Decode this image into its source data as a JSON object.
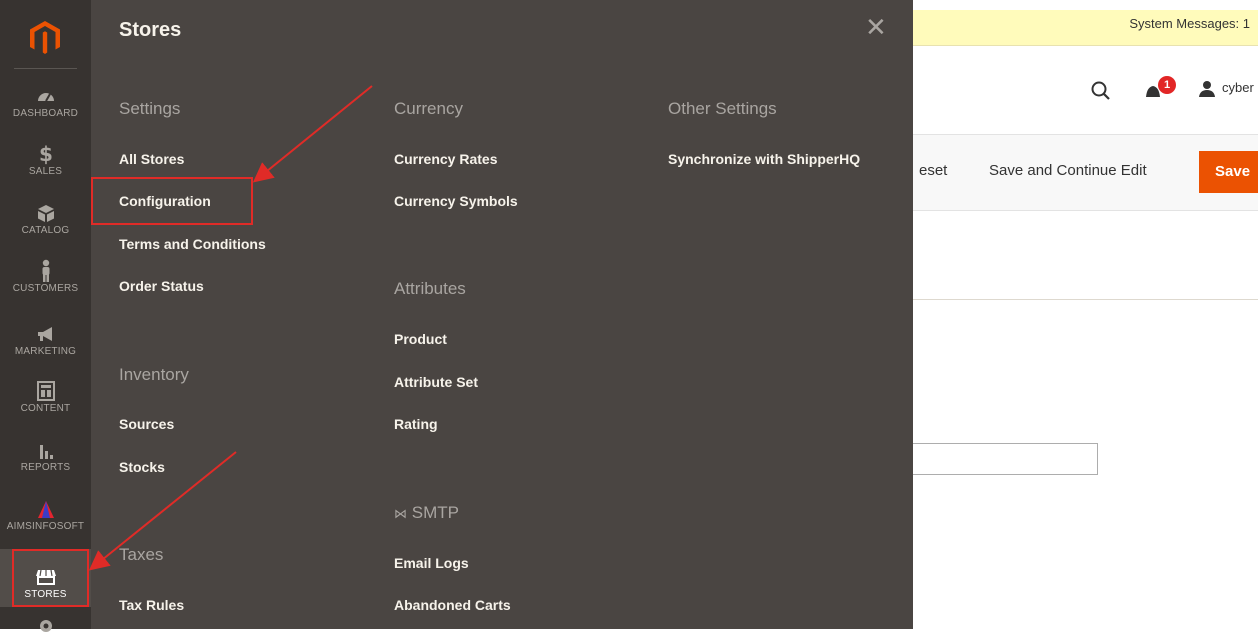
{
  "nav": {
    "items": [
      {
        "label": "DASHBOARD",
        "icon": "dashboard-icon"
      },
      {
        "label": "SALES",
        "icon": "dollar-icon"
      },
      {
        "label": "CATALOG",
        "icon": "box-icon"
      },
      {
        "label": "CUSTOMERS",
        "icon": "person-icon"
      },
      {
        "label": "MARKETING",
        "icon": "megaphone-icon"
      },
      {
        "label": "CONTENT",
        "icon": "layout-icon"
      },
      {
        "label": "REPORTS",
        "icon": "bar-chart-icon"
      },
      {
        "label": "AIMSINFOSOFT",
        "icon": "aims-logo-icon"
      },
      {
        "label": "STORES",
        "icon": "store-icon"
      }
    ]
  },
  "flyout": {
    "title": "Stores",
    "settings": {
      "heading": "Settings",
      "links": [
        "All Stores",
        "Configuration",
        "Terms and Conditions",
        "Order Status"
      ]
    },
    "inventory": {
      "heading": "Inventory",
      "links": [
        "Sources",
        "Stocks"
      ]
    },
    "taxes": {
      "heading": "Taxes",
      "links": [
        "Tax Rules"
      ]
    },
    "currency": {
      "heading": "Currency",
      "links": [
        "Currency Rates",
        "Currency Symbols"
      ]
    },
    "attributes": {
      "heading": "Attributes",
      "links": [
        "Product",
        "Attribute Set",
        "Rating"
      ]
    },
    "smtp": {
      "heading": "SMTP",
      "links": [
        "Email Logs",
        "Abandoned Carts"
      ]
    },
    "other": {
      "heading": "Other Settings",
      "links": [
        "Synchronize with ShipperHQ"
      ]
    }
  },
  "page": {
    "system_messages": "System Messages: 1",
    "notification_count": "1",
    "username": "cyber",
    "reset_label": "eset",
    "save_continue_label": "Save and Continue Edit",
    "save_label": "Save"
  },
  "colors": {
    "nav_bg": "#373330",
    "flyout_bg": "#4a4542",
    "accent": "#eb5202",
    "annotation": "#e02b27"
  }
}
